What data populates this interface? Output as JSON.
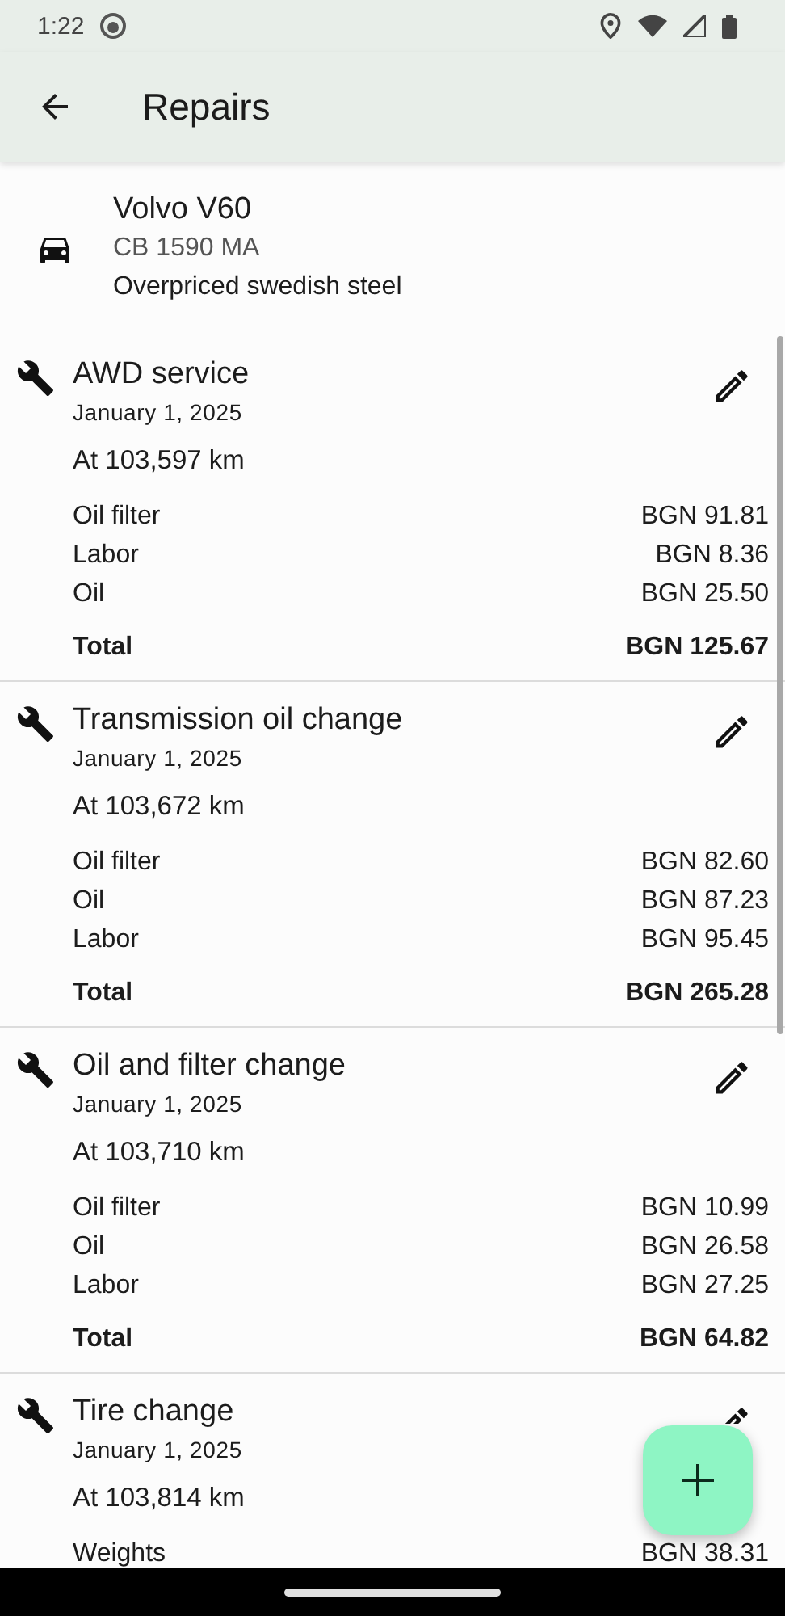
{
  "status_bar": {
    "time": "1:22"
  },
  "app_bar": {
    "title": "Repairs"
  },
  "vehicle": {
    "name": "Volvo V60",
    "plate": "CB 1590 MA",
    "description": "Overpriced swedish steel"
  },
  "repairs": [
    {
      "title": "AWD service",
      "date": "January 1, 2025",
      "odometer": "At 103,597 km",
      "items": [
        {
          "name": "Oil filter",
          "price": "BGN 91.81"
        },
        {
          "name": "Labor",
          "price": "BGN 8.36"
        },
        {
          "name": "Oil",
          "price": "BGN 25.50"
        }
      ],
      "total_label": "Total",
      "total": "BGN 125.67"
    },
    {
      "title": "Transmission oil change",
      "date": "January 1, 2025",
      "odometer": "At 103,672 km",
      "items": [
        {
          "name": "Oil filter",
          "price": "BGN 82.60"
        },
        {
          "name": "Oil",
          "price": "BGN 87.23"
        },
        {
          "name": "Labor",
          "price": "BGN 95.45"
        }
      ],
      "total_label": "Total",
      "total": "BGN 265.28"
    },
    {
      "title": "Oil and filter change",
      "date": "January 1, 2025",
      "odometer": "At 103,710 km",
      "items": [
        {
          "name": "Oil filter",
          "price": "BGN 10.99"
        },
        {
          "name": "Oil",
          "price": "BGN 26.58"
        },
        {
          "name": "Labor",
          "price": "BGN 27.25"
        }
      ],
      "total_label": "Total",
      "total": "BGN 64.82"
    },
    {
      "title": "Tire change",
      "date": "January 1, 2025",
      "odometer": "At 103,814 km",
      "items": [
        {
          "name": "Weights",
          "price": "BGN 38.31"
        }
      ]
    }
  ]
}
